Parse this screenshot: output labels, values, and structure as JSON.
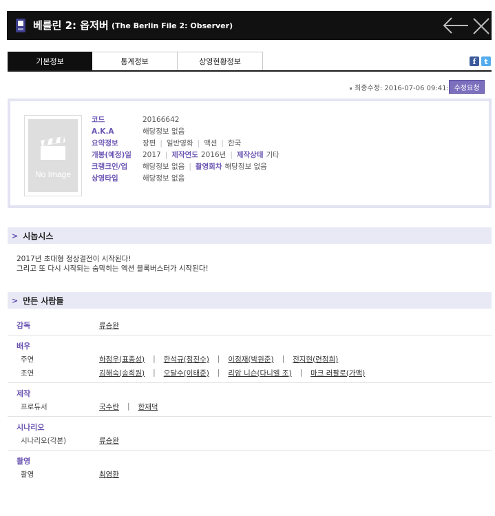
{
  "header": {
    "title_main": "베를린 2: 옵저버",
    "title_sub": "(The Berlin File 2: Observer)"
  },
  "tabs": [
    {
      "label": "기본정보",
      "active": true
    },
    {
      "label": "통계정보",
      "active": false
    },
    {
      "label": "상영현황정보",
      "active": false
    }
  ],
  "social": {
    "facebook": "f",
    "twitter": "t"
  },
  "modified": {
    "text": "최종수정: 2016-07-06 09:41:21",
    "edit_button": "수정요청"
  },
  "poster": {
    "text": "No Image"
  },
  "info": {
    "code_label": "코드",
    "code": "20166642",
    "aka_label": "A.K.A",
    "aka": "해당정보 없음",
    "summary_label": "요약정보",
    "summary": [
      "장편",
      "일반영화",
      "액션",
      "한국"
    ],
    "release_label": "개봉(예정)일",
    "release": "2017",
    "prodyear_label": "제작연도",
    "prodyear": "2016년",
    "status_label": "제작상태",
    "status": "기타",
    "crank_label": "크랭크인/업",
    "crank": "해당정보 없음",
    "shoot_label": "촬영회차",
    "shoot": "해당정보 없음",
    "screen_label": "상영타입",
    "screen": "해당정보 없음"
  },
  "synopsis": {
    "title": "시놉시스",
    "line1": "2017년 초대형 정상결전이 시작된다!",
    "line2": "그리고 또 다시 시작되는 숨막히는 액션 블록버스터가 시작된다!"
  },
  "staff": {
    "title": "만든 사람들",
    "director": {
      "title": "감독",
      "names": [
        "류승완"
      ]
    },
    "actors": {
      "title": "배우",
      "lead_role": "주연",
      "lead": [
        "하정우(표종성)",
        "한석규(정진수)",
        "이정재(박원준)",
        "전지현(련정희)"
      ],
      "support_role": "조연",
      "support": [
        "김해숙(송희원)",
        "오달수(이태준)",
        "리암 니슨(다니엘 조)",
        "마크 러팔로(가맥)"
      ]
    },
    "production": {
      "title": "제작",
      "role": "프로듀서",
      "names": [
        "국수란",
        "한재덕"
      ]
    },
    "scenario": {
      "title": "시나리오",
      "role": "시나리오(각본)",
      "names": [
        "류승완"
      ]
    },
    "camera": {
      "title": "촬영",
      "role": "촬영",
      "names": [
        "최영환"
      ]
    }
  }
}
